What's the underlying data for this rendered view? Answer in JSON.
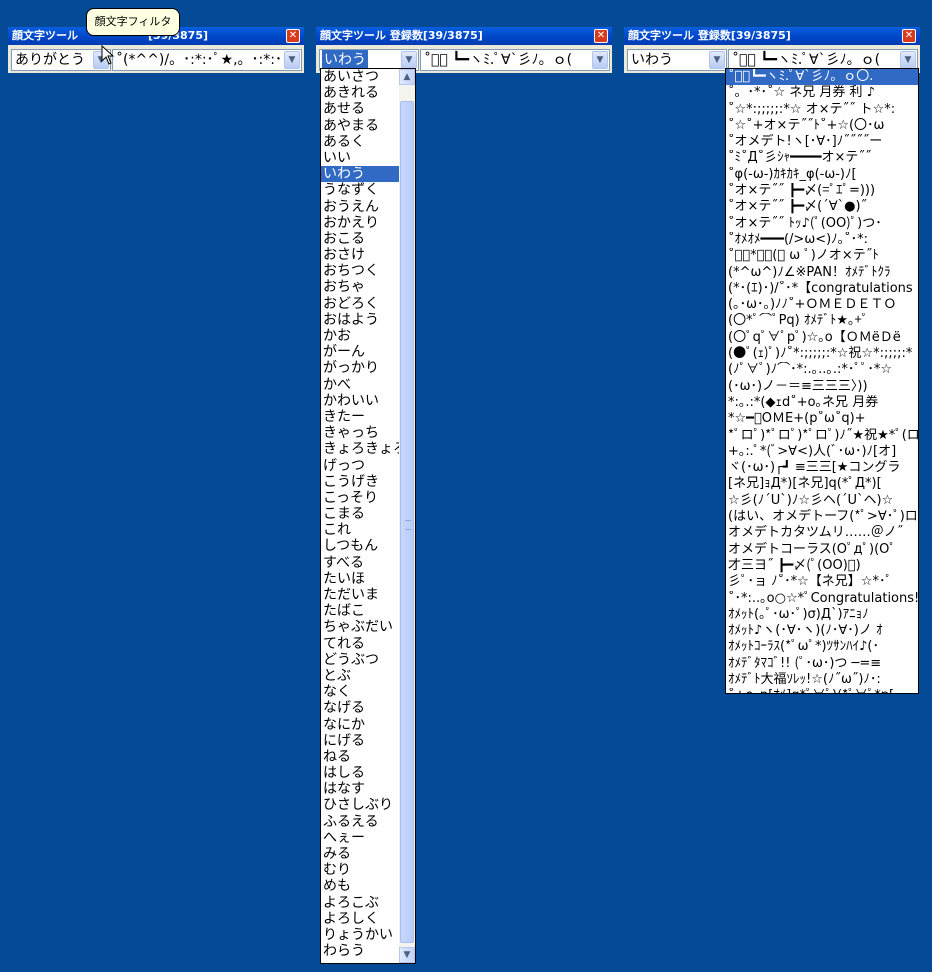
{
  "window1": {
    "title": "顔文字ツール 登録数[39/3875]",
    "title_visible": "顔文字ツール",
    "title_tail": "[39/3875]",
    "filter_value": "ありがとう",
    "kaomoji_value": "˚(*^^)/。･:*:･ﾟ★,。･:*:･ﾟ"
  },
  "tooltip": {
    "text": "顔文字フィルタ"
  },
  "window2": {
    "title": "顔文字ツール 登録数[39/3875]",
    "filter_value": "いわう",
    "kaomoji_value": "˚ﾟﾟ ┗━ヽﾐ.ﾟ∀`彡ﾉ。ｏ(",
    "filter_options": [
      "あいさつ",
      "あきれる",
      "あせる",
      "あやまる",
      "あるく",
      "いい",
      "いわう",
      "うなずく",
      "おうえん",
      "おかえり",
      "おこる",
      "おさけ",
      "おちつく",
      "おちゃ",
      "おどろく",
      "おはよう",
      "かお",
      "がーん",
      "がっかり",
      "かべ",
      "かわいい",
      "きたー",
      "きゃっち",
      "きょろきょろ",
      "げっつ",
      "こうげき",
      "こっそり",
      "こまる",
      "これ",
      "しつもん",
      "すべる",
      "たいほ",
      "ただいま",
      "たばこ",
      "ちゃぶだい",
      "てれる",
      "どうぶつ",
      "とぶ",
      "なく",
      "なげる",
      "なにか",
      "にげる",
      "ねる",
      "はしる",
      "はなす",
      "ひさしぶり",
      "ふるえる",
      "へぇー",
      "みる",
      "むり",
      "めも",
      "よろこぶ",
      "よろしく",
      "りょうかい",
      "わらう"
    ],
    "selected_option": "いわう"
  },
  "window3": {
    "title": "顔文字ツール 登録数[39/3875]",
    "filter_value": "いわう",
    "kaomoji_value": "˚ﾟﾟ ┗━ヽﾐ.ﾟ∀`彡ﾉ。ｏ(",
    "kaomoji_options": [
      "˚ﾟﾟ┗━ヽﾐ.ﾟ∀`彡ﾉ。ｏ〇.",
      "˚。･*･˚☆ ネ兄 月券 利 ♪",
      "˚☆*:;;;;;:*☆ オ×テ˝˝ ト☆*:",
      "˚☆˚+オ×テ˝˝ﾄ˚+☆(〇･ω",
      "˚オメデト!ヽ[･∀･]ﾉ˝˝˝˝ー",
      "˚ﾐ˚Д˚彡ｼｬ━━━━オ×テ˝˝",
      "˚φ(-ω-)ｶｷｶｷ_φ(-ω-)ﾉ[",
      "˚オ×テ˝˝ ┣━〆(=ﾟｴﾟ=)))",
      "˚オ×テ˝˝ ┣━〆(´∀`●)˝",
      "˚オ×テ˝˝ ﾄｯ♪(ﾟ(OO)ﾟ)つ･",
      "˚ｵﾒｵﾒ━━━(/>ω<)ﾉ｡˚･*:",
      "˚ﾟ･*･｡(ﾟ ω ﾟ)ノオ×テ˝ﾄ",
      "(*^ω^)ﾉ∠※PAN！ｵﾒﾃﾞﾄｸﾗ",
      "(*･(ｴ)･)/˚･*【congratulations",
      "(｡･ω･｡)ﾉﾉ˚+ＯＭＥＤＥＴＯ",
      "(〇*ﾟ⌒ﾟPq) ｵﾒﾃﾞﾄ★｡+ﾟ",
      "(〇ﾟqﾟ∀ﾟpﾟ)☆｡o【ＯＭëＤë",
      "(●ﾟ(ｪ)ﾟ)ﾉ˚*:;;;;;:*☆祝☆*:;;;;:*",
      "(ﾉﾟ∀ﾟ)ﾉ⌒･*:.｡..｡.:*･ﾟﾟ･*☆",
      "(･ω･)ノ－＝≡三三三〉))",
      "*:｡.:*(◆ｪd˚+o｡ネ兄 月券",
      "*☆━ﾟOＭË+(p˚ω˚q)+",
      "*ﾟロﾟ)*ﾟロﾟ)*ﾟロﾟ)ﾉ˝★祝★*ﾟ(ロ",
      "+｡:.ﾟ*(ﾞ>∀<)人(ﾞ･ω･)ﾉ[オ]",
      "ヾ(･ω･)┌┛ ≡三三[★コングラ",
      "[ネ兄]ｮД*)[ネ兄]q(*ﾟД*)[",
      "☆彡(ﾉ´U`)ﾉ☆彡ヘ(´U`ヘ)☆",
      "(はい、オメデトーフ(*ﾟ>∀･ﾟ)ロ",
      "オメデトカタツムリ……＠ノ˝",
      "オメデトコーラス(Оﾟдﾟ)(Оﾟ",
      "才三ヨ˝ ┣━〆(ﾟ(OO)ﾟ)",
      "彡ﾟ･ョ ﾉ˚･*☆【ネ兄】☆*･ﾟ",
      "˚･*:..｡o○☆*ﾟCongratulations!",
      "ｵﾒｯﾄ(｡ﾟ･ω･ﾟ)σ)Д`)ｱﾆｮﾉ",
      "ｵﾒｯﾄ♪ヽ(･∀･ヽ)(ﾉ･∀･)ノ ｵ",
      "ｵﾒｯﾄｺｰﾗｽ(*ﾟωﾟ*)ﾂｻﾝﾊｲ♪(･",
      "ｵﾒﾃﾞﾀﾏｺﾞ!! (ﾟ･ω･)つ ─=≡",
      "ｵﾒﾃﾞﾄ大福ｿﾚｯ!☆(ﾉ˝ω˝)ﾉ･:",
      "˚+o｡p[ｵﾒ]q*ﾟ∀ﾟ)(*ﾟ∀ﾟ*p["
    ]
  },
  "icons": {
    "close": "close-icon",
    "dropdown": "chevron-down-icon",
    "cursor": "mouse-pointer-icon"
  },
  "colors": {
    "desktop": "#054a96",
    "titlebar": "#0047c8",
    "selection": "#316ac5",
    "close": "#d83a1c"
  }
}
